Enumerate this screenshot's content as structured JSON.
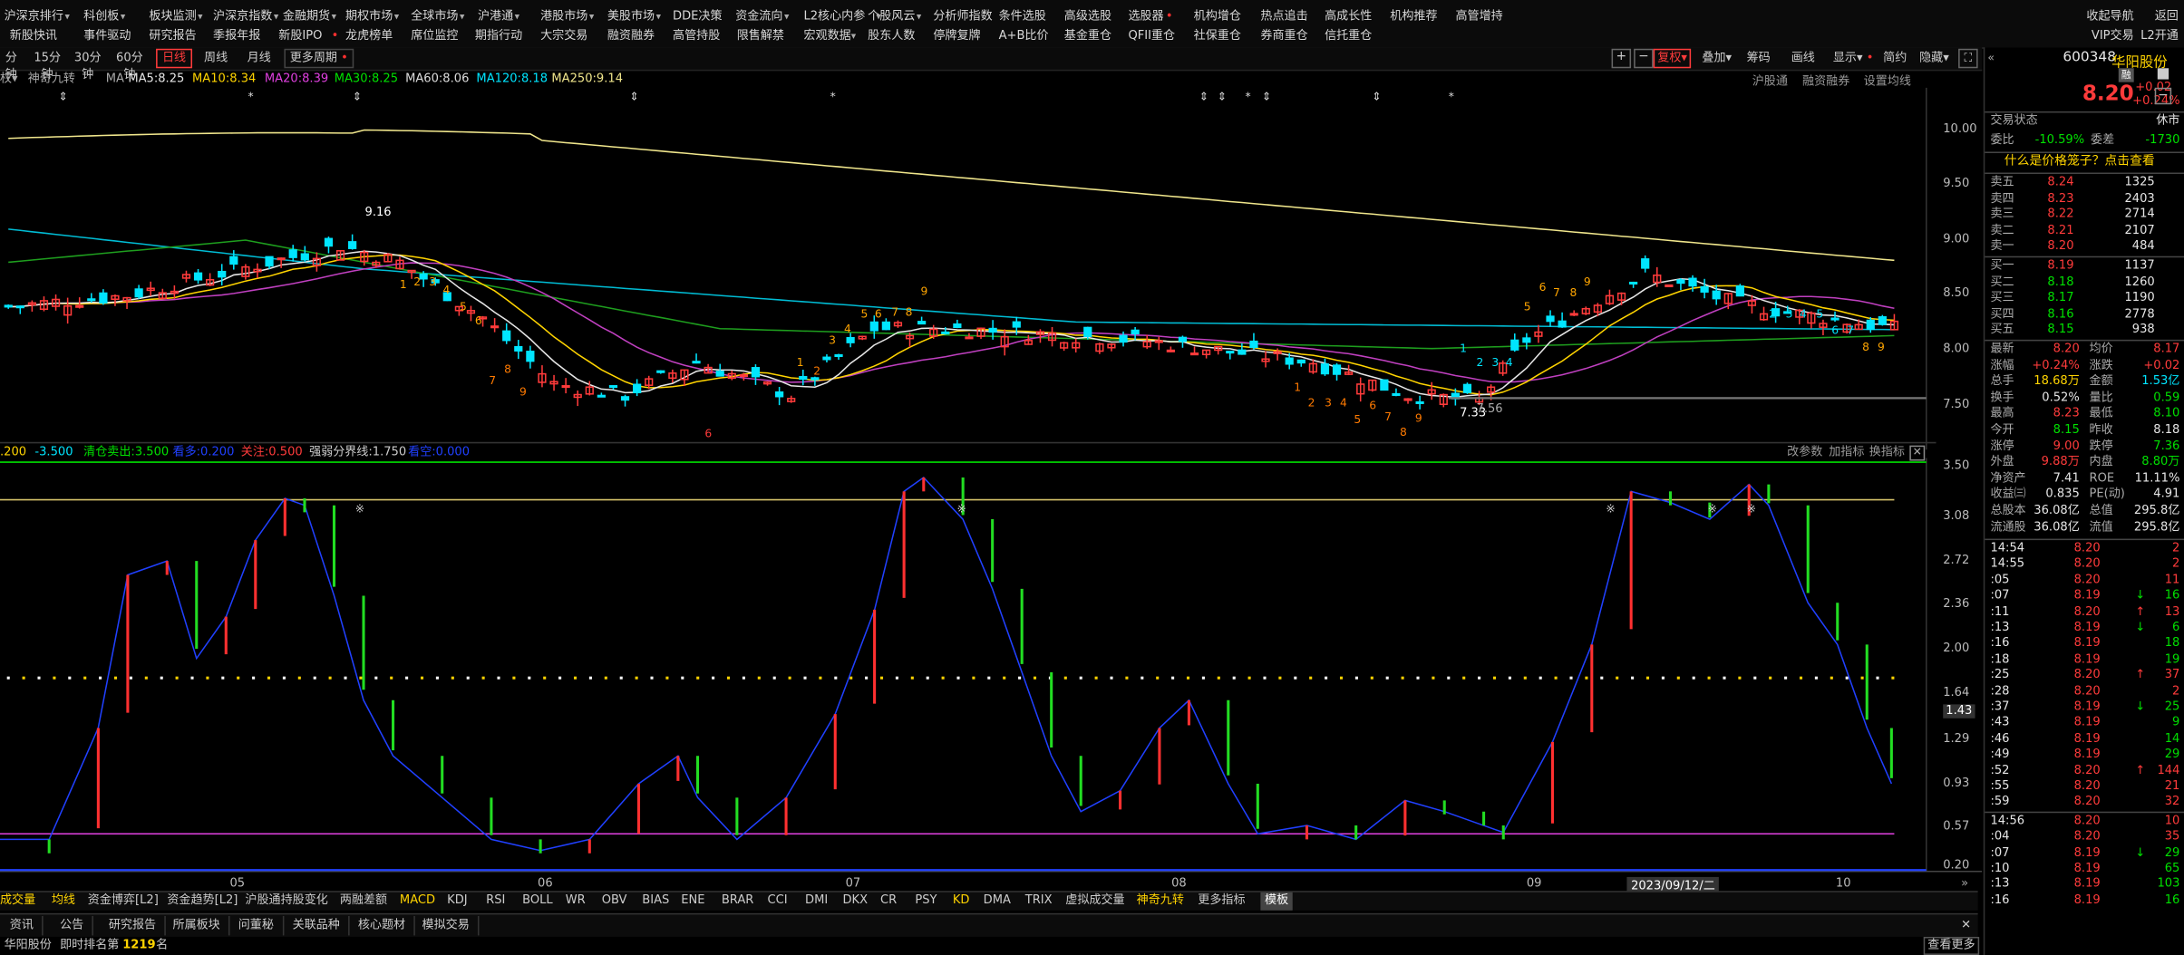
{
  "menu_row1": [
    "沪深京排行",
    "科创板",
    "板块监测",
    "沪深京指数",
    "金融期货",
    "期权市场",
    "全球市场",
    "沪港通",
    "港股市场",
    "美股市场",
    "DDE决策",
    "资金流向",
    "L2核心内参",
    "个股风云",
    "分析师指数",
    "条件选股",
    "高级选股",
    "选股器",
    "机构增仓",
    "热点追击",
    "高成长性",
    "机构推荐",
    "高管增持"
  ],
  "menu_row2": [
    "新股快讯",
    "事件驱动",
    "研究报告",
    "季报年报",
    "新股IPO",
    "龙虎榜单",
    "席位监控",
    "期指行动",
    "大宗交易",
    "融资融券",
    "高管持股",
    "限售解禁",
    "宏观数据",
    "股东人数",
    "停牌复牌",
    "A+B比价",
    "基金重仓",
    "QFII重仓",
    "社保重仓",
    "券商重仓",
    "信托重仓"
  ],
  "top_right": {
    "r1": "收起导航",
    "r1b": "返回",
    "r2": "VIP交易",
    "r2b": "L2开通"
  },
  "periods": [
    "分钟",
    "15分钟",
    "30分钟",
    "60分钟",
    "日线",
    "周线",
    "月线",
    "更多周期"
  ],
  "active_period": "日线",
  "chart_tools": [
    "复权",
    "叠加",
    "筹码",
    "画线",
    "显示",
    "简约",
    "隐藏"
  ],
  "ma_bar": {
    "label": "神奇九转",
    "ma": "MA",
    "ma5": "MA5:8.25",
    "ma10": "MA10:8.34",
    "ma20": "MA20:8.39",
    "ma30": "MA30:8.25",
    "ma60": "MA60:8.06",
    "ma120": "MA120:8.18",
    "ma250": "MA250:9.14"
  },
  "chart_right_links": [
    "沪股通",
    "融资融券",
    "设置均线"
  ],
  "ind_bar": {
    "a": ".200",
    "b": "-3.500",
    "c": "清仓卖出:3.500",
    "d": "看多:0.200",
    "e": "关注:0.500",
    "f": "强弱分界线:1.750",
    "g": "看空:0.000"
  },
  "ind_right_links": [
    "改参数",
    "加指标",
    "换指标"
  ],
  "chart_data": {
    "type": "candlestick",
    "main_y_ticks": [
      "10.00",
      "9.50",
      "9.00",
      "8.50",
      "8.00",
      "7.50"
    ],
    "sub_y_ticks": [
      "3.50",
      "3.08",
      "2.72",
      "2.36",
      "2.00",
      "1.64",
      "1.43",
      "1.29",
      "0.93",
      "0.57",
      "0.20"
    ],
    "x_ticks": [
      "05",
      "06",
      "07",
      "08",
      "09",
      "2023/09/12/二",
      "10"
    ],
    "annotations": [
      "9.16",
      "7.33",
      "7.56"
    ],
    "nine_turn_labels": [
      "1",
      "2",
      "3",
      "4",
      "5",
      "6",
      "7",
      "8",
      "9"
    ]
  },
  "bottom_tabs": [
    "成交量",
    "均线",
    "资金博弈[L2]",
    "资金趋势[L2]",
    "沪股通持股变化",
    "两融差额",
    "MACD",
    "KDJ",
    "RSI",
    "BOLL",
    "WR",
    "OBV",
    "BIAS",
    "ENE",
    "BRAR",
    "CCI",
    "DMI",
    "DKX",
    "CR",
    "PSY",
    "KD",
    "DMA",
    "TRIX",
    "虚拟成交量",
    "神奇九转",
    "更多指标",
    "模板"
  ],
  "info_tabs": [
    "资讯",
    "公告",
    "研究报告",
    "所属板块",
    "问董秘",
    "关联品种",
    "核心题材",
    "模拟交易"
  ],
  "status": {
    "name": "华阳股份",
    "rank_label": "即时排名第",
    "rank": "1219",
    "unit": "名",
    "more": "查看更多"
  },
  "stock": {
    "code": "600348",
    "name": "华阳股份",
    "price": "8.20",
    "change": "+0.02",
    "pct": "+0.24%",
    "badge": "融"
  },
  "panel": {
    "trade_state_label": "交易状态",
    "trade_state": "休市",
    "weibi_label": "委比",
    "weibi": "-10.59%",
    "weicha_label": "委差",
    "weicha": "-1730",
    "promo": "什么是价格笼子？点击查看",
    "asks": [
      [
        "卖五",
        "8.24",
        "1325"
      ],
      [
        "卖四",
        "8.23",
        "2403"
      ],
      [
        "卖三",
        "8.22",
        "2714"
      ],
      [
        "卖二",
        "8.21",
        "2107"
      ],
      [
        "卖一",
        "8.20",
        "484"
      ]
    ],
    "bids": [
      [
        "买一",
        "8.19",
        "1137"
      ],
      [
        "买二",
        "8.18",
        "1260"
      ],
      [
        "买三",
        "8.17",
        "1190"
      ],
      [
        "买四",
        "8.16",
        "2778"
      ],
      [
        "买五",
        "8.15",
        "938"
      ]
    ],
    "stats": [
      [
        "最新",
        "8.20",
        "均价",
        "8.17"
      ],
      [
        "涨幅",
        "+0.24%",
        "涨跌",
        "+0.02"
      ],
      [
        "总手",
        "18.68万",
        "金额",
        "1.53亿"
      ],
      [
        "换手",
        "0.52%",
        "量比",
        "0.59"
      ],
      [
        "最高",
        "8.23",
        "最低",
        "8.10"
      ],
      [
        "今开",
        "8.15",
        "昨收",
        "8.18"
      ],
      [
        "涨停",
        "9.00",
        "跌停",
        "7.36"
      ],
      [
        "外盘",
        "9.88万",
        "内盘",
        "8.80万"
      ],
      [
        "净资产",
        "7.41",
        "ROE",
        "11.11%"
      ],
      [
        "收益㈢",
        "0.835",
        "PE(动)",
        "4.91"
      ],
      [
        "总股本",
        "36.08亿",
        "总值",
        "295.8亿"
      ],
      [
        "流通股",
        "36.08亿",
        "流值",
        "295.8亿"
      ]
    ],
    "ticks": [
      [
        "14:54",
        "8.20",
        "2",
        ""
      ],
      [
        "14:55",
        "8.20",
        "2",
        ""
      ],
      [
        ":05",
        "8.20",
        "11",
        ""
      ],
      [
        ":07",
        "8.19",
        "16",
        "↓"
      ],
      [
        ":11",
        "8.20",
        "13",
        "↑"
      ],
      [
        ":13",
        "8.19",
        "6",
        "↓"
      ],
      [
        ":16",
        "8.19",
        "18",
        ""
      ],
      [
        ":18",
        "8.19",
        "19",
        ""
      ],
      [
        ":25",
        "8.20",
        "37",
        "↑"
      ],
      [
        ":28",
        "8.20",
        "2",
        ""
      ],
      [
        ":37",
        "8.19",
        "25",
        "↓"
      ],
      [
        ":43",
        "8.19",
        "9",
        ""
      ],
      [
        ":46",
        "8.19",
        "14",
        ""
      ],
      [
        ":49",
        "8.19",
        "29",
        ""
      ],
      [
        ":52",
        "8.20",
        "144",
        "↑"
      ],
      [
        ":55",
        "8.20",
        "21",
        ""
      ],
      [
        ":59",
        "8.20",
        "32",
        ""
      ],
      [
        "14:56",
        "8.20",
        "10",
        ""
      ],
      [
        ":04",
        "8.20",
        "35",
        ""
      ],
      [
        ":07",
        "8.19",
        "29",
        "↓"
      ],
      [
        ":10",
        "8.19",
        "65",
        ""
      ],
      [
        ":13",
        "8.19",
        "103",
        ""
      ],
      [
        ":16",
        "8.19",
        "16",
        ""
      ]
    ]
  }
}
